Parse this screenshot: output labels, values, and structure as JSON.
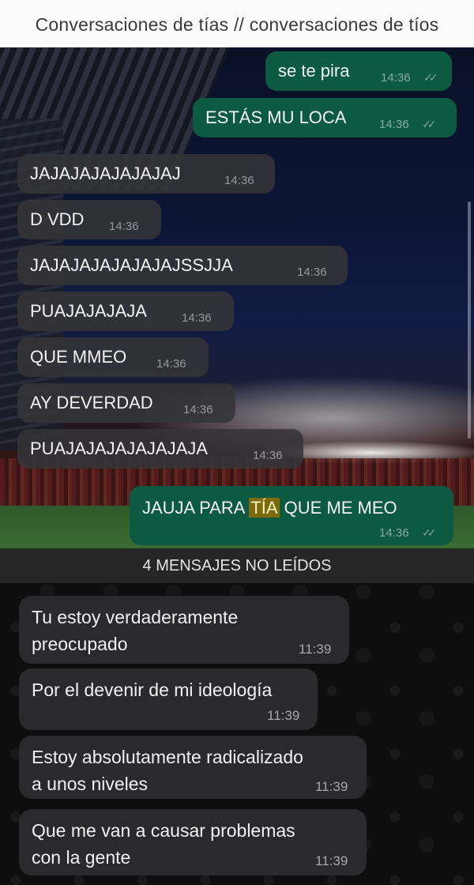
{
  "caption": "Conversaciones de tías // conversaciones de tíos",
  "chat1": {
    "outgoing_top": [
      {
        "text": "se te pira",
        "time": "14:36"
      },
      {
        "text": "ESTÁS MU LOCA",
        "time": "14:36"
      }
    ],
    "incoming": [
      {
        "text": "JAJAJAJAJAJAJAJ",
        "time": "14:36"
      },
      {
        "text": "D VDD",
        "time": "14:36"
      },
      {
        "text": "JAJAJAJAJAJAJAJSSJJA",
        "time": "14:36"
      },
      {
        "text": "PUAJAJAJAJA",
        "time": "14:36"
      },
      {
        "text": "QUE MMEO",
        "time": "14:36"
      },
      {
        "text": "AY DEVERDAD",
        "time": "14:36"
      },
      {
        "text": "PUAJAJAJAJAJAJAJA",
        "time": "14:36"
      }
    ],
    "outgoing_last": {
      "before": "JAUJA PARA ",
      "highlight": "TÍA",
      "after": " QUE ME MEO",
      "time": "14:36"
    }
  },
  "chat2": {
    "unread_label": "4 MENSAJES NO LEÍDOS",
    "messages": [
      {
        "line1": "Tu estoy verdaderamente",
        "line2": "preocupado",
        "time": "11:39"
      },
      {
        "line1": "Por el devenir de mi ideología",
        "line2": "",
        "time": "11:39"
      },
      {
        "line1": "Estoy absolutamente radicalizado",
        "line2": "a unos niveles",
        "time": "11:39"
      },
      {
        "line1": "Que me van a causar problemas",
        "line2": "con la gente",
        "time": "11:39"
      }
    ]
  },
  "colors": {
    "outgoing_bubble": "#0d5a43",
    "incoming_bubble": "#2a2a2c",
    "highlight": "#7d6a0a"
  }
}
